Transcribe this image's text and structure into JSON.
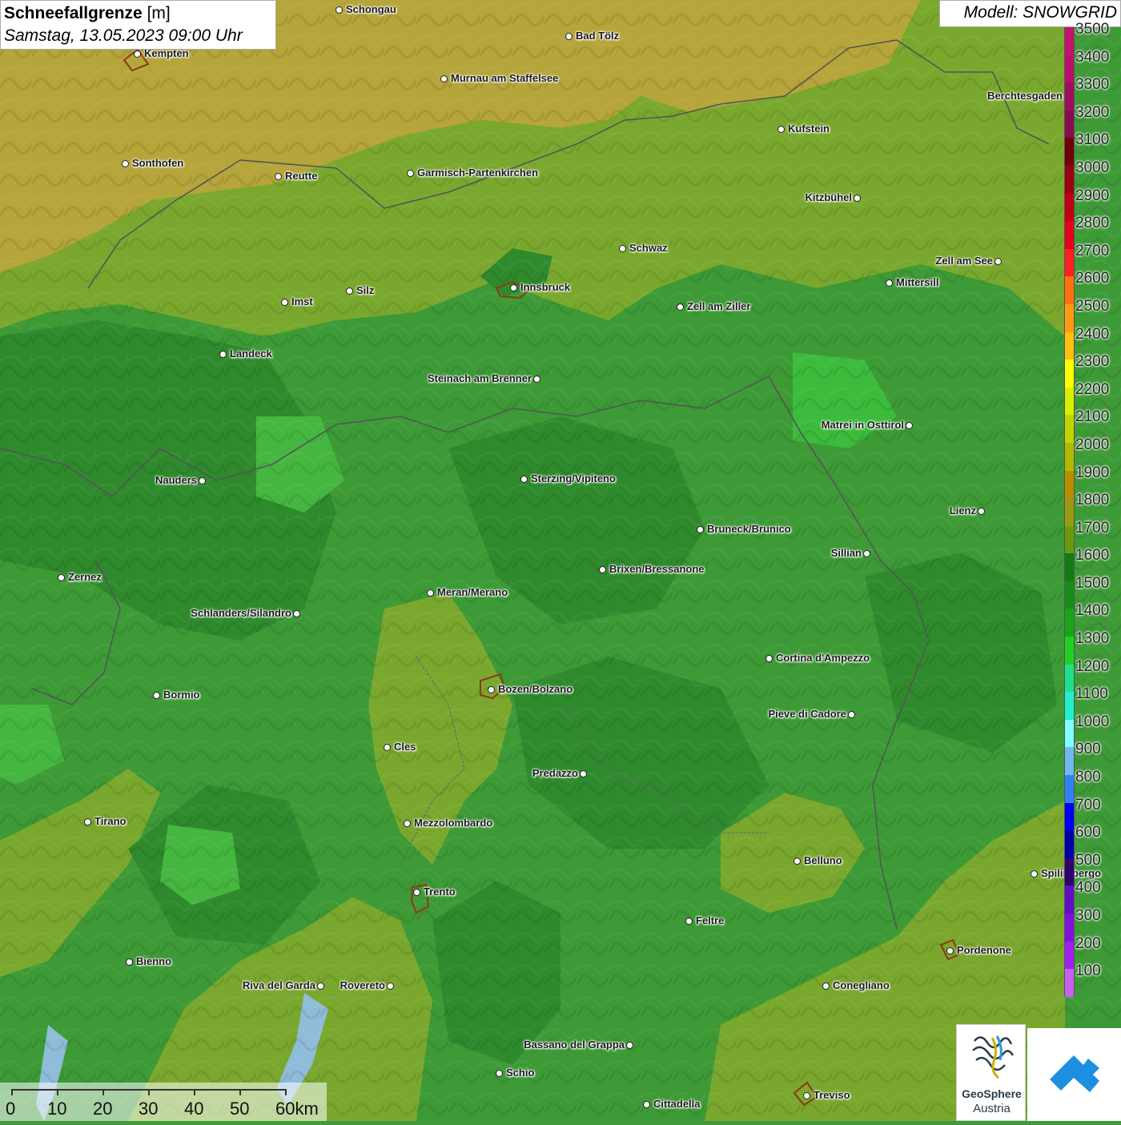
{
  "title": {
    "label_bold": "Schneefallgrenze",
    "unit": "[m]",
    "datetime": "Samstag, 13.05.2023 09:00 Uhr"
  },
  "model": "Modell: SNOWGRID",
  "legend": [
    {
      "value": "3500",
      "color": "#c4136e"
    },
    {
      "value": "3400",
      "color": "#b8106a"
    },
    {
      "value": "3300",
      "color": "#a00d60"
    },
    {
      "value": "3200",
      "color": "#8a0a52"
    },
    {
      "value": "3100",
      "color": "#700008"
    },
    {
      "value": "3000",
      "color": "#9a0010"
    },
    {
      "value": "2900",
      "color": "#c20014"
    },
    {
      "value": "2800",
      "color": "#e5001c"
    },
    {
      "value": "2700",
      "color": "#ff2020"
    },
    {
      "value": "2600",
      "color": "#ff7010"
    },
    {
      "value": "2500",
      "color": "#ff9a10"
    },
    {
      "value": "2400",
      "color": "#ffc010"
    },
    {
      "value": "2300",
      "color": "#ffff00"
    },
    {
      "value": "2200",
      "color": "#d8f000"
    },
    {
      "value": "2100",
      "color": "#c2d400"
    },
    {
      "value": "2000",
      "color": "#b2b800"
    },
    {
      "value": "1900",
      "color": "#b88e00"
    },
    {
      "value": "1800",
      "color": "#9a9a10"
    },
    {
      "value": "1700",
      "color": "#6a9a10"
    },
    {
      "value": "1600",
      "color": "#157a15"
    },
    {
      "value": "1500",
      "color": "#168d16"
    },
    {
      "value": "1400",
      "color": "#18a518"
    },
    {
      "value": "1300",
      "color": "#20d020"
    },
    {
      "value": "1200",
      "color": "#20e090"
    },
    {
      "value": "1100",
      "color": "#20f0d0"
    },
    {
      "value": "1000",
      "color": "#80ffff"
    },
    {
      "value": "900",
      "color": "#70b8f0"
    },
    {
      "value": "800",
      "color": "#3080f0"
    },
    {
      "value": "700",
      "color": "#0000f0"
    },
    {
      "value": "600",
      "color": "#0000a8"
    },
    {
      "value": "500",
      "color": "#300070"
    },
    {
      "value": "400",
      "color": "#6010c0"
    },
    {
      "value": "300",
      "color": "#8010e0"
    },
    {
      "value": "200",
      "color": "#a020f0"
    },
    {
      "value": "100",
      "color": "#c860f0"
    }
  ],
  "cities": [
    {
      "name": "Schongau",
      "side": "right"
    },
    {
      "name": "Bad Tölz",
      "side": "right"
    },
    {
      "name": "Kempten",
      "side": "right"
    },
    {
      "name": "Murnau am Staffelsee",
      "side": "right"
    },
    {
      "name": "Berchtesgaden",
      "side": "left"
    },
    {
      "name": "Kufstein",
      "side": "right"
    },
    {
      "name": "Sonthofen",
      "side": "right"
    },
    {
      "name": "Reutte",
      "side": "right"
    },
    {
      "name": "Garmisch-Partenkirchen",
      "side": "right"
    },
    {
      "name": "Kitzbühel",
      "side": "left"
    },
    {
      "name": "Schwaz",
      "side": "right"
    },
    {
      "name": "Zell am See",
      "side": "left"
    },
    {
      "name": "Mittersill",
      "side": "right"
    },
    {
      "name": "Innsbruck",
      "side": "right"
    },
    {
      "name": "Imst",
      "side": "right"
    },
    {
      "name": "Silz",
      "side": "right"
    },
    {
      "name": "Zell am Ziller",
      "side": "right"
    },
    {
      "name": "Landeck",
      "side": "right"
    },
    {
      "name": "Steinach am Brenner",
      "side": "left"
    },
    {
      "name": "Matrei in Osttirol",
      "side": "left"
    },
    {
      "name": "Nauders",
      "side": "left"
    },
    {
      "name": "Sterzing/Vipiteno",
      "side": "right"
    },
    {
      "name": "Lienz",
      "side": "left"
    },
    {
      "name": "Bruneck/Brunico",
      "side": "right"
    },
    {
      "name": "Sillian",
      "side": "left"
    },
    {
      "name": "Zernez",
      "side": "right"
    },
    {
      "name": "Brixen/Bressanone",
      "side": "right"
    },
    {
      "name": "Meran/Merano",
      "side": "right"
    },
    {
      "name": "Schlanders/Silandro",
      "side": "left"
    },
    {
      "name": "Cortina d'Ampezzo",
      "side": "right"
    },
    {
      "name": "Bozen/Bolzano",
      "side": "right"
    },
    {
      "name": "Bormio",
      "side": "right"
    },
    {
      "name": "Pieve di Cadore",
      "side": "left"
    },
    {
      "name": "Cles",
      "side": "right"
    },
    {
      "name": "Predazzo",
      "side": "left"
    },
    {
      "name": "Tirano",
      "side": "right"
    },
    {
      "name": "Mezzolombardo",
      "side": "right"
    },
    {
      "name": "Belluno",
      "side": "right"
    },
    {
      "name": "Spilimbergo",
      "side": "right"
    },
    {
      "name": "Trento",
      "side": "right"
    },
    {
      "name": "Feltre",
      "side": "right"
    },
    {
      "name": "Pordenone",
      "side": "right"
    },
    {
      "name": "Bienno",
      "side": "right"
    },
    {
      "name": "Riva del Garda",
      "side": "left"
    },
    {
      "name": "Rovereto",
      "side": "left"
    },
    {
      "name": "Conegliano",
      "side": "right"
    },
    {
      "name": "Bassano del Grappa",
      "side": "left"
    },
    {
      "name": "Schio",
      "side": "right"
    },
    {
      "name": "Treviso",
      "side": "right"
    },
    {
      "name": "Cittadella",
      "side": "right"
    }
  ],
  "scale": {
    "ticks": [
      "0",
      "10",
      "20",
      "30",
      "40",
      "50",
      "60km"
    ]
  },
  "logos": {
    "geosphere_line1": "GeoSphere",
    "geosphere_line2": "Austria"
  }
}
